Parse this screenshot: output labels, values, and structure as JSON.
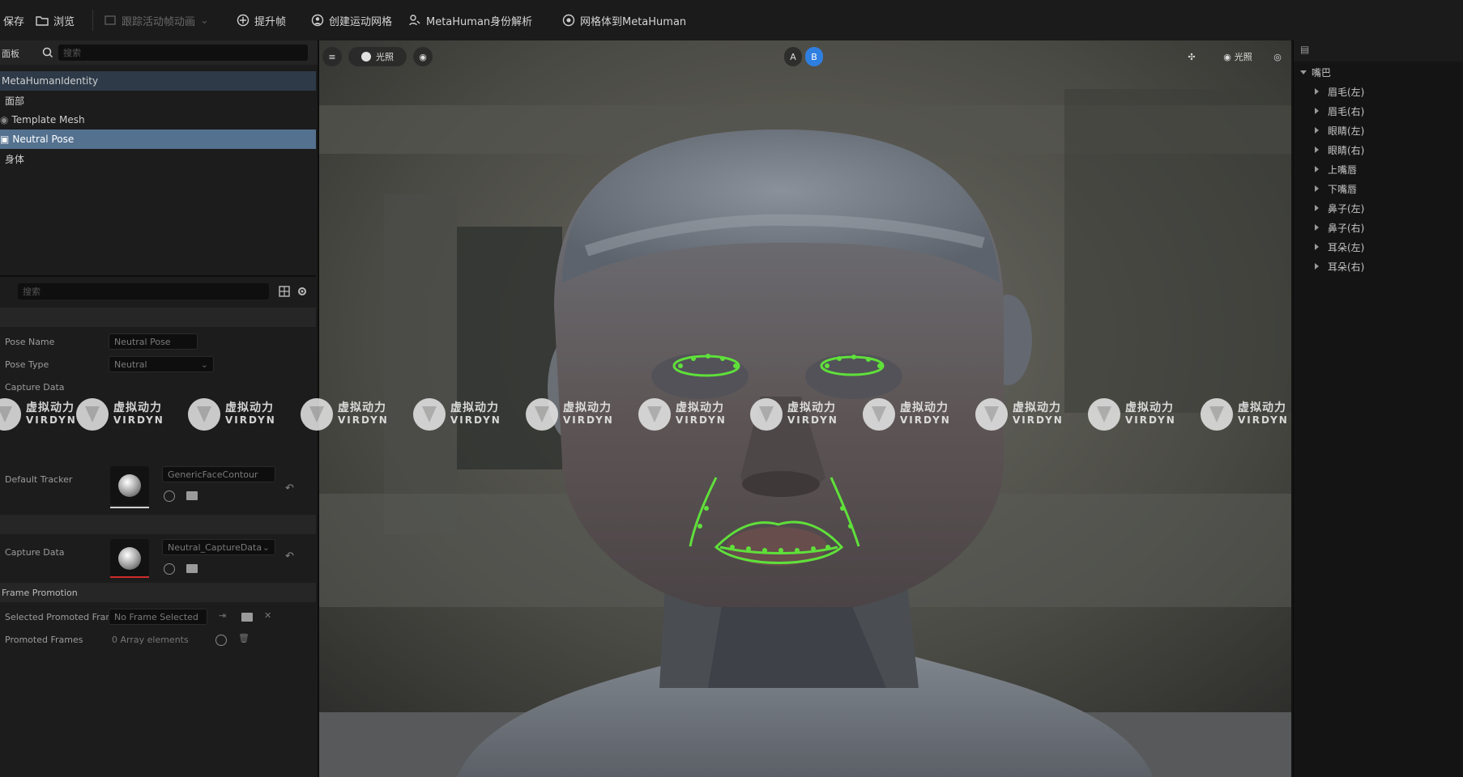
{
  "toolbar": {
    "items": [
      {
        "label": "保存",
        "icon": "save-icon"
      },
      {
        "label": "浏览",
        "icon": "folder-browse-icon"
      },
      {
        "label": "跟踪活动帧动画",
        "icon": "track-active-frame-icon",
        "disabled": true
      },
      {
        "label": "提升帧",
        "icon": "promote-frame-icon"
      },
      {
        "label": "创建运动网格",
        "icon": "create-mesh-icon"
      },
      {
        "label": "MetaHuman身份解析",
        "icon": "metahuman-identity-solve-icon"
      },
      {
        "label": "网格体到MetaHuman",
        "icon": "mesh-to-metahuman-icon"
      }
    ]
  },
  "left_panel": {
    "outliner": {
      "tab_label": "面板",
      "search_placeholder": "搜索",
      "rows": [
        {
          "label": "MetaHumanIdentity",
          "selected": false,
          "dark": true
        },
        {
          "label": "面部",
          "selected": false,
          "dark": false
        },
        {
          "label": "Template Mesh",
          "selected": false,
          "dark": false
        },
        {
          "label": "Neutral Pose",
          "selected": true,
          "dark": false
        },
        {
          "label": "身体",
          "selected": false,
          "dark": false
        }
      ]
    },
    "details": {
      "search_placeholder": "搜索",
      "rows": [
        {
          "label": "Pose Name",
          "value": "Neutral Pose"
        },
        {
          "label": "Pose Type",
          "value": "Neutral"
        },
        {
          "label": "Capture Data",
          "value": ""
        },
        {
          "label": "Default Tracker",
          "value": "GenericFaceContour"
        },
        {
          "label": "Capture Data",
          "value": "Neutral_CaptureData"
        }
      ],
      "category_promotion": "Frame Promotion",
      "promoted_frame_label": "Selected Promoted Frame",
      "promoted_frame_value": "No Frame Selected",
      "promoted_frames_label": "Promoted Frames",
      "promoted_frames_value": "0 Array elements"
    }
  },
  "viewport": {
    "view_mode": "光照",
    "ab_left": "A",
    "ab_right": "B",
    "right_label": "光照"
  },
  "watermark": {
    "cn": "虚拟动力",
    "en": "VIRDYN"
  },
  "right_panel": {
    "root_label": "嘴巴",
    "items": [
      "眉毛(左)",
      "眉毛(右)",
      "眼睛(左)",
      "眼睛(右)",
      "上嘴唇",
      "下嘴唇",
      "鼻子(左)",
      "鼻子(右)",
      "耳朵(左)",
      "耳朵(右)"
    ]
  },
  "colors": {
    "selection": "#54718f",
    "tracker_green": "#5fe03a",
    "accent_blue": "#2f7fe0"
  }
}
